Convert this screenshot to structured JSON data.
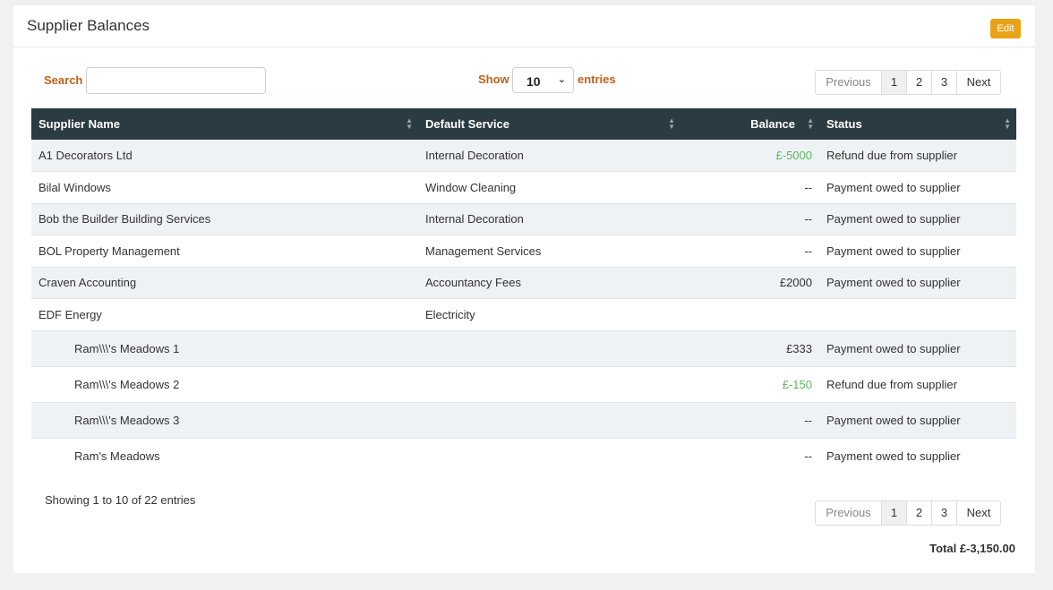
{
  "header": {
    "title": "Supplier Balances",
    "edit_label": "Edit"
  },
  "controls": {
    "search_label": "Search",
    "search_value": "",
    "show_label": "Show",
    "entries_value": "10",
    "entries_label": "entries"
  },
  "pagination": {
    "previous": "Previous",
    "pages": [
      "1",
      "2",
      "3"
    ],
    "active_page": "1",
    "next": "Next"
  },
  "table": {
    "columns": [
      "Supplier Name",
      "Default Service",
      "Balance",
      "Status"
    ],
    "rows": [
      {
        "supplier": "A1 Decorators Ltd",
        "service": "Internal Decoration",
        "balance": "£-5000",
        "status": "Refund due from supplier"
      },
      {
        "supplier": "Bilal Windows",
        "service": "Window Cleaning",
        "balance": "--",
        "status": "Payment owed to supplier"
      },
      {
        "supplier": "Bob the Builder Building Services",
        "service": "Internal Decoration",
        "balance": "--",
        "status": "Payment owed to supplier"
      },
      {
        "supplier": "BOL Property Management",
        "service": "Management Services",
        "balance": "--",
        "status": "Payment owed to supplier"
      },
      {
        "supplier": "Craven Accounting",
        "service": "Accountancy Fees",
        "balance": "£2000",
        "status": "Payment owed to supplier"
      },
      {
        "supplier": "EDF Energy",
        "service": "Electricity",
        "balance": "",
        "status": ""
      },
      {
        "supplier": "Ram\\\\\\'s Meadows 1",
        "service": "",
        "balance": "£333",
        "status": "Payment owed to supplier"
      },
      {
        "supplier": "Ram\\\\\\'s Meadows 2",
        "service": "",
        "balance": "£-150",
        "status": "Refund due from supplier"
      },
      {
        "supplier": "Ram\\\\\\'s Meadows 3",
        "service": "",
        "balance": "--",
        "status": "Payment owed to supplier"
      },
      {
        "supplier": "Ram's Meadows",
        "service": "",
        "balance": "--",
        "status": "Payment owed to supplier"
      }
    ]
  },
  "footer": {
    "info": "Showing 1 to 10 of 22 entries",
    "total_label": "Total",
    "total_value": "£-3,150.00"
  },
  "colors": {
    "header_bg": "#2b3b42",
    "label_orange": "#c0601a",
    "negative_green": "#5cb85c",
    "edit_button": "#e8a317"
  }
}
